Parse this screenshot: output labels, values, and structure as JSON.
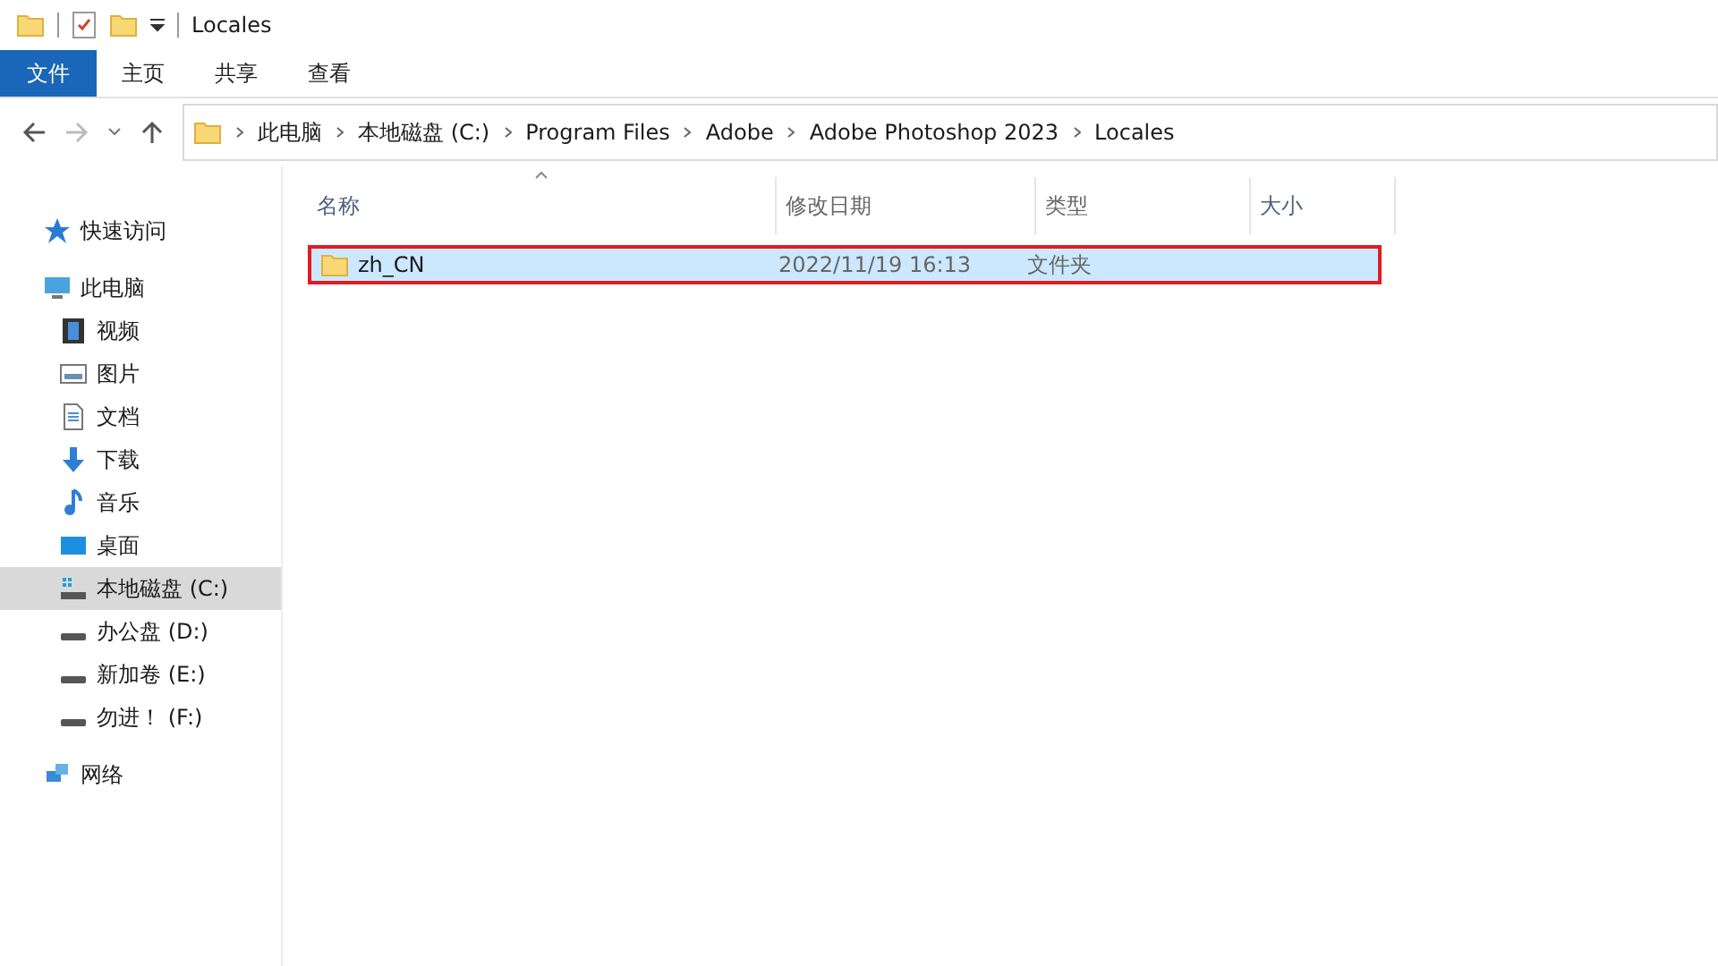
{
  "window": {
    "title": "Locales"
  },
  "ribbon_tabs": [
    {
      "label": "文件",
      "kind": "file",
      "selected": false
    },
    {
      "label": "主页",
      "kind": "tab",
      "selected": false
    },
    {
      "label": "共享",
      "kind": "tab",
      "selected": false
    },
    {
      "label": "查看",
      "kind": "tab",
      "selected": false
    }
  ],
  "breadcrumb": [
    "此电脑",
    "本地磁盘 (C:)",
    "Program Files",
    "Adobe",
    "Adobe Photoshop 2023",
    "Locales"
  ],
  "sidebar": {
    "items": [
      {
        "label": "快速访问",
        "kind": "star",
        "selected": false
      },
      {
        "label": "此电脑",
        "kind": "pc",
        "selected": false,
        "children": [
          {
            "label": "视频",
            "kind": "video",
            "selected": false
          },
          {
            "label": "图片",
            "kind": "picture",
            "selected": false
          },
          {
            "label": "文档",
            "kind": "document",
            "selected": false
          },
          {
            "label": "下载",
            "kind": "download",
            "selected": false
          },
          {
            "label": "音乐",
            "kind": "music",
            "selected": false
          },
          {
            "label": "桌面",
            "kind": "desktop",
            "selected": false
          },
          {
            "label": "本地磁盘 (C:)",
            "kind": "system-drive",
            "selected": true
          },
          {
            "label": "办公盘 (D:)",
            "kind": "drive",
            "selected": false
          },
          {
            "label": "新加卷 (E:)",
            "kind": "drive",
            "selected": false
          },
          {
            "label": "勿进！ (F:)",
            "kind": "drive",
            "selected": false
          }
        ]
      },
      {
        "label": "网络",
        "kind": "network",
        "selected": false
      }
    ]
  },
  "table": {
    "columns": [
      "名称",
      "修改日期",
      "类型",
      "大小"
    ],
    "rows": [
      {
        "name": "zh_CN",
        "modified": "2022/11/19 16:13",
        "type": "文件夹",
        "size": "",
        "selected": true,
        "outlined": true
      }
    ]
  }
}
